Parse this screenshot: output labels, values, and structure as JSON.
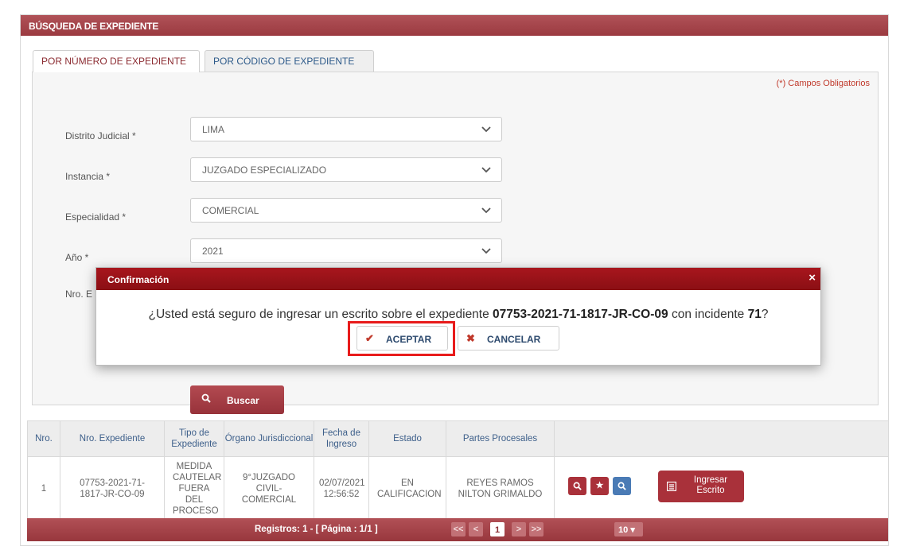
{
  "panel": {
    "title": "BÚSQUEDA DE EXPEDIENTE"
  },
  "tabs": [
    {
      "label": "POR NÚMERO DE EXPEDIENTE",
      "active": true
    },
    {
      "label": "POR CÓDIGO DE EXPEDIENTE",
      "active": false
    }
  ],
  "form": {
    "required_note": "(*) Campos Obligatorios",
    "fields": [
      {
        "label": "Distrito Judicial *",
        "value": "LIMA"
      },
      {
        "label": "Instancia *",
        "value": "JUZGADO ESPECIALIZADO"
      },
      {
        "label": "Especialidad *",
        "value": "COMERCIAL"
      },
      {
        "label": "Año *",
        "value": "2021"
      }
    ],
    "nro_label_partial": "Nro. E",
    "search_button": "Buscar"
  },
  "modal": {
    "title": "Confirmación",
    "close_icon": "×",
    "message_prefix": "¿Usted está seguro de ingresar un escrito sobre el expediente ",
    "expediente": "07753-2021-71-1817-JR-CO-09",
    "message_middle": " con incidente ",
    "incidente": "71",
    "message_suffix": "?",
    "accept_label": "ACEPTAR",
    "cancel_label": "CANCELAR"
  },
  "table": {
    "headers": [
      "Nro.",
      "Nro. Expediente",
      "Tipo de Expediente",
      "Órgano Jurisdiccional",
      "Fecha de Ingreso",
      "Estado",
      "Partes Procesales",
      ""
    ],
    "rows": [
      {
        "nro": "1",
        "expediente": "07753-2021-71-1817-JR-CO-09",
        "tipo": "MEDIDA CAUTELAR FUERA DEL PROCESO",
        "organo": "9°JUZGADO CIVIL-COMERCIAL",
        "fecha": "02/07/2021 12:56:52",
        "estado": "EN CALIFICACION",
        "partes": "REYES RAMOS NILTON GRIMALDO",
        "ingresar_label": "Ingresar Escrito"
      }
    ]
  },
  "footer": {
    "registros": "Registros: 1 - [ Página : 1/1 ]",
    "first": "<<",
    "prev": "<",
    "current_page": "1",
    "next": ">",
    "last": ">>",
    "page_size": "10"
  },
  "colors": {
    "header_red": "#9b3a40",
    "modal_red": "#8a0f14",
    "highlight": "#e81b1b",
    "link_blue": "#3d5f8a"
  }
}
